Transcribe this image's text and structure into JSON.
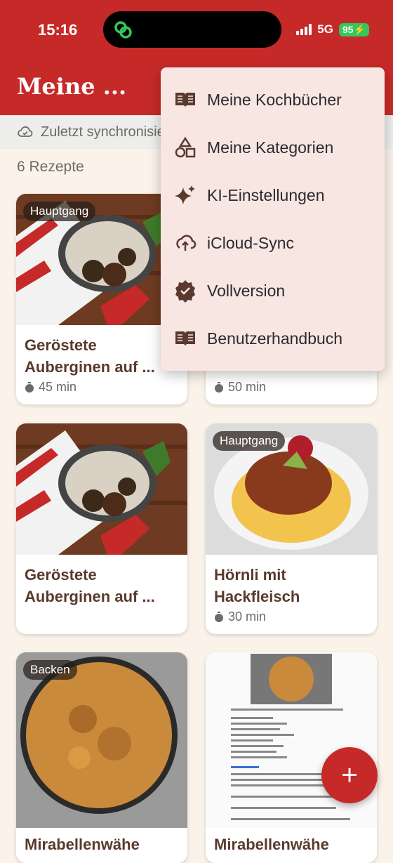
{
  "status_bar": {
    "time": "15:16",
    "network": "5G",
    "battery": "95"
  },
  "app_bar": {
    "title": "Meine ..."
  },
  "sync": {
    "text": "Zuletzt synchronisiert"
  },
  "recipes_count": "6 Rezepte",
  "recipes": [
    {
      "tag": "Hauptgang",
      "title_line1": "Geröstete",
      "title_line2": "Auberginen auf ...",
      "time": "45 min"
    },
    {
      "tag": "",
      "title_line1": "",
      "title_line2": "",
      "time": "50 min"
    },
    {
      "tag": "",
      "title_line1": "Geröstete",
      "title_line2": "Auberginen auf ...",
      "time": ""
    },
    {
      "tag": "Hauptgang",
      "title_line1": "Hörnli mit",
      "title_line2": "Hackfleisch",
      "time": "30 min"
    },
    {
      "tag": "Backen",
      "title_line1": "Mirabellenwähe",
      "title_line2": "",
      "time": ""
    },
    {
      "tag": "",
      "title_line1": "Mirabellenwähe",
      "title_line2": "",
      "time": ""
    }
  ],
  "menu": {
    "items": [
      {
        "label": "Meine Kochbücher",
        "icon": "book-icon"
      },
      {
        "label": "Meine Kategorien",
        "icon": "shapes-icon"
      },
      {
        "label": "KI-Einstellungen",
        "icon": "sparkle-icon"
      },
      {
        "label": "iCloud-Sync",
        "icon": "cloud-sync-icon"
      },
      {
        "label": "Vollversion",
        "icon": "verified-icon"
      },
      {
        "label": "Benutzerhandbuch",
        "icon": "book-icon"
      }
    ]
  },
  "fab": {
    "label": "+"
  },
  "colors": {
    "primary": "#c62a28",
    "background": "#fbf3ea",
    "menu": "#f8e6e3",
    "title_text": "#5a3a2e"
  }
}
